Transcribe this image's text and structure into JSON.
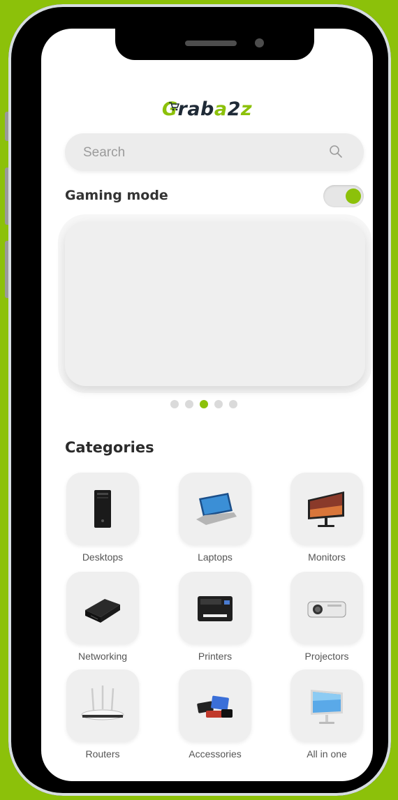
{
  "app": {
    "logo_text": "Graba2z",
    "logo_parts": [
      "G",
      "rab",
      "a",
      "2",
      "z"
    ]
  },
  "search": {
    "placeholder": "Search"
  },
  "gaming_mode": {
    "label": "Gaming mode",
    "enabled": true
  },
  "carousel": {
    "dot_count": 5,
    "active_index": 2
  },
  "categories": {
    "title": "Categories",
    "items": [
      {
        "label": "Desktops",
        "icon": "desktop-tower-icon"
      },
      {
        "label": "Laptops",
        "icon": "laptop-icon"
      },
      {
        "label": "Monitors",
        "icon": "monitor-icon"
      },
      {
        "label": "Networking",
        "icon": "network-drive-icon"
      },
      {
        "label": "Printers",
        "icon": "printer-icon"
      },
      {
        "label": "Projectors",
        "icon": "projector-icon"
      },
      {
        "label": "Routers",
        "icon": "router-icon"
      },
      {
        "label": "Accessories",
        "icon": "accessories-icon"
      },
      {
        "label": "All in one",
        "icon": "all-in-one-pc-icon"
      }
    ]
  },
  "colors": {
    "accent": "#8cc10a",
    "background": "#8cc10a",
    "dark": "#1f2a36"
  }
}
